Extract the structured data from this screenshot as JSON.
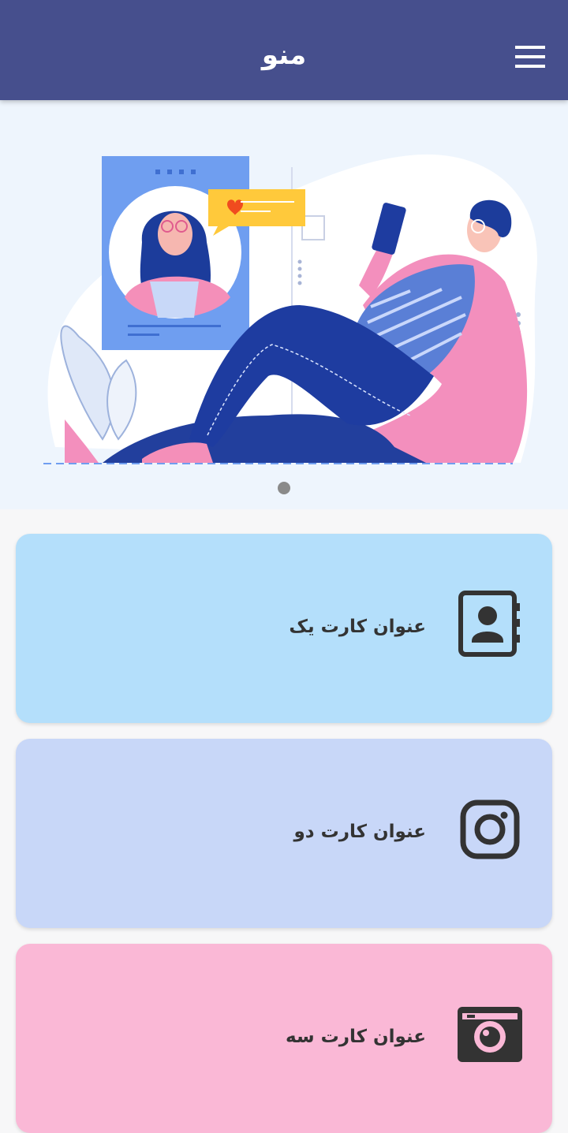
{
  "appbar": {
    "title": "منو",
    "background": "#464f8d",
    "menu_icon": "hamburger-menu-icon"
  },
  "carousel": {
    "background": "#eef5fd",
    "slide_count": 1,
    "active_index": 0
  },
  "cards": [
    {
      "title": "عنوان کارت یک",
      "icon": "contact-book-icon",
      "background": "#b4dffb"
    },
    {
      "title": "عنوان کارت دو",
      "icon": "instagram-icon",
      "background": "#c8d7f8"
    },
    {
      "title": "عنوان کارت سه",
      "icon": "camera-icon",
      "background": "#fab8d6"
    }
  ]
}
